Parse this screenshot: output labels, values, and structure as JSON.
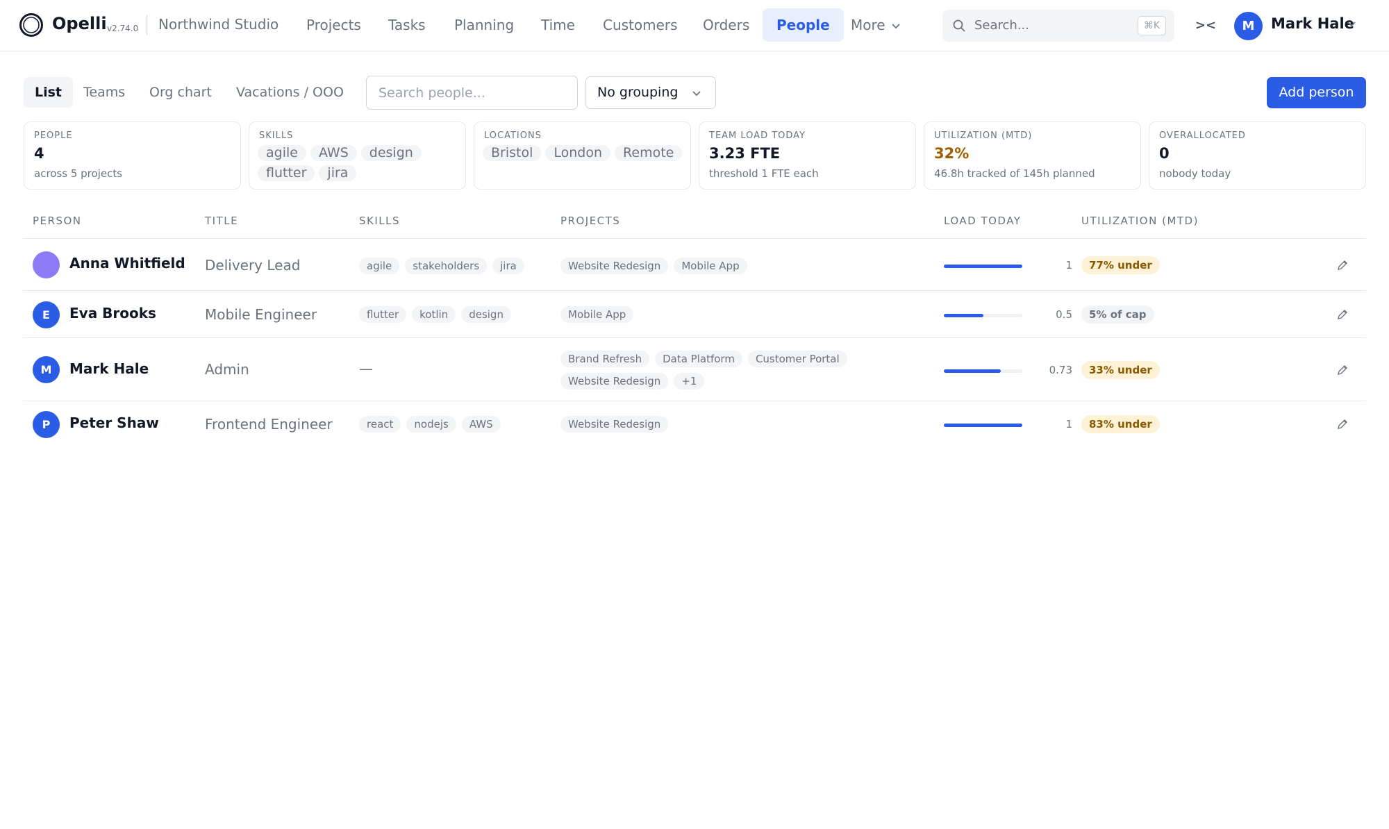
{
  "app": {
    "name": "Opelli",
    "version": "v2.74.0",
    "workspace": "Northwind Studio"
  },
  "nav": {
    "items": [
      "Projects",
      "Tasks",
      "Planning",
      "Time",
      "Customers",
      "Orders",
      "People"
    ],
    "active": "People",
    "more_label": "More"
  },
  "search": {
    "placeholder": "Search...",
    "shortcut": "⌘K"
  },
  "user": {
    "initial": "M",
    "name": "Mark Hale"
  },
  "toolbar": {
    "tabs": [
      "List",
      "Teams",
      "Org chart",
      "Vacations / OOO"
    ],
    "active_tab": "List",
    "people_search_placeholder": "Search people...",
    "grouping": "No grouping",
    "add_button": "Add person"
  },
  "stats": {
    "people": {
      "label": "PEOPLE",
      "value": "4",
      "sub": "across 5 projects"
    },
    "skills": {
      "label": "SKILLS",
      "tags": [
        "agile",
        "AWS",
        "design",
        "flutter",
        "jira"
      ]
    },
    "locations": {
      "label": "LOCATIONS",
      "tags": [
        "Bristol",
        "London",
        "Remote"
      ]
    },
    "team_load": {
      "label": "TEAM LOAD TODAY",
      "value": "3.23 FTE",
      "sub": "threshold 1 FTE each"
    },
    "utilization": {
      "label": "UTILIZATION (MTD)",
      "value": "32%",
      "sub": "46.8h tracked of 145h planned"
    },
    "overallocated": {
      "label": "OVERALLOCATED",
      "value": "0",
      "sub": "nobody today"
    }
  },
  "table": {
    "columns": {
      "person": "PERSON",
      "title": "TITLE",
      "skills": "SKILLS",
      "projects": "PROJECTS",
      "load": "LOAD TODAY",
      "util": "UTILIZATION (MTD)"
    },
    "empty_skills": "—",
    "rows": [
      {
        "initial": "",
        "name": "Anna Whitfield",
        "title": "Delivery Lead",
        "skills": [
          "agile",
          "stakeholders",
          "jira"
        ],
        "projects": [
          "Website Redesign",
          "Mobile App"
        ],
        "load_text": "1",
        "load_fraction": 1,
        "util": "77% under",
        "util_kind": "under"
      },
      {
        "initial": "E",
        "name": "Eva Brooks",
        "title": "Mobile Engineer",
        "skills": [
          "flutter",
          "kotlin",
          "design"
        ],
        "projects": [
          "Mobile App"
        ],
        "load_text": "0.5",
        "load_fraction": 0.5,
        "util": "5% of cap",
        "util_kind": "cap"
      },
      {
        "initial": "M",
        "name": "Mark Hale",
        "title": "Admin",
        "skills": [],
        "projects": [
          "Brand Refresh",
          "Data Platform",
          "Customer Portal",
          "Website Redesign",
          "+1"
        ],
        "load_text": "0.73",
        "load_fraction": 0.73,
        "util": "33% under",
        "util_kind": "under"
      },
      {
        "initial": "P",
        "name": "Peter Shaw",
        "title": "Frontend Engineer",
        "skills": [
          "react",
          "nodejs",
          "AWS"
        ],
        "projects": [
          "Website Redesign"
        ],
        "load_text": "1",
        "load_fraction": 1,
        "util": "83% under",
        "util_kind": "under"
      }
    ]
  }
}
